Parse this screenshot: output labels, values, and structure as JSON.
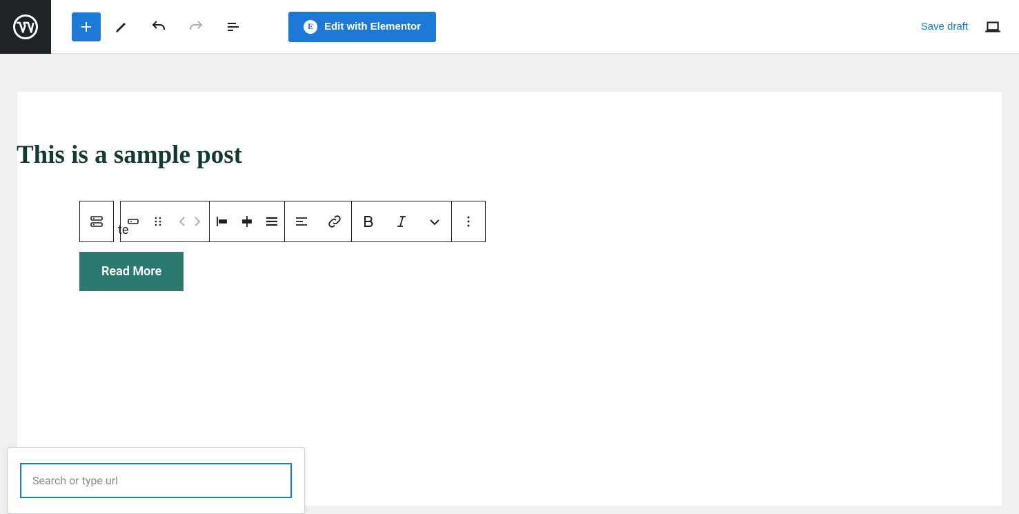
{
  "header": {
    "elementor_label": "Edit with Elementor",
    "save_draft": "Save draft"
  },
  "post": {
    "title": "This is a sample post",
    "peek_text": "te",
    "button_label": "Read More"
  },
  "link_popover": {
    "placeholder": "Search or type url"
  }
}
